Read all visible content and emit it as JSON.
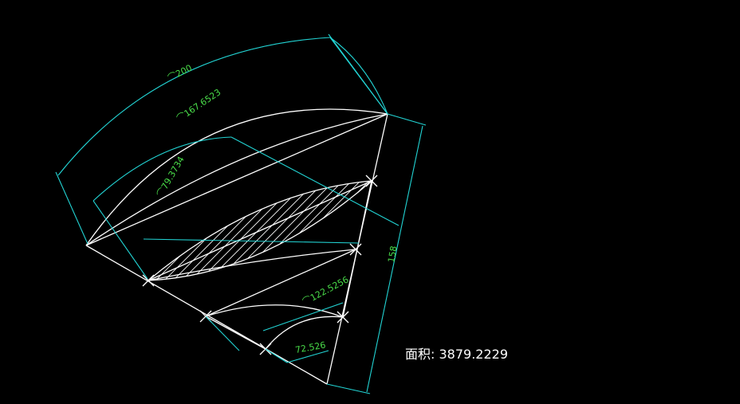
{
  "colors": {
    "background": "#000000",
    "geometry": "#ffffff",
    "dimension_line": "#22d3d3",
    "dimension_text": "#4ade4a"
  },
  "dimensions": {
    "outer_arc": "⌒200",
    "inner_arc": "⌒167.6523",
    "mid_arc": "⌒79.3734",
    "small_arc": "⌒122.5256",
    "bottom_width": "72.526",
    "side_length": "158"
  },
  "area": {
    "label": "面积:",
    "value": "3879.2229"
  }
}
